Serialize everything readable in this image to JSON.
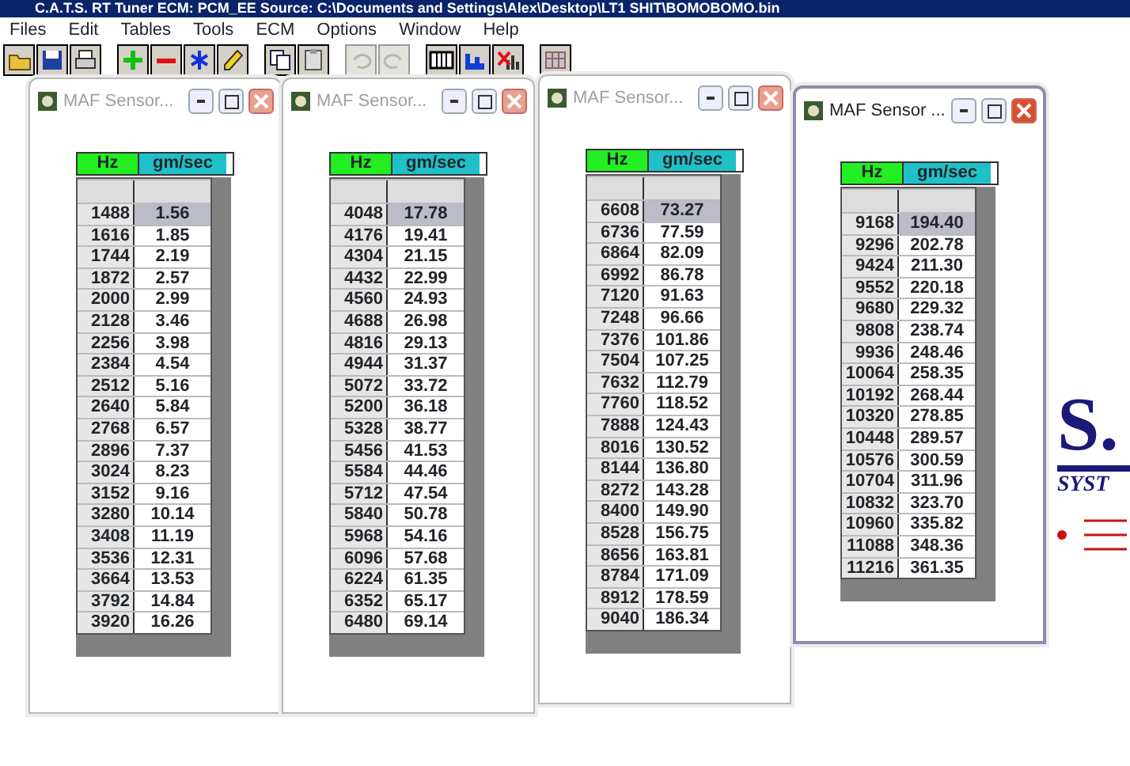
{
  "window": {
    "title": "C.A.T.S. RT Tuner     ECM: PCM_EE     Source: C:\\Documents and Settings\\Alex\\Desktop\\LT1 SHIT\\BOMOBOMO.bin"
  },
  "menu": [
    "Files",
    "Edit",
    "Tables",
    "Tools",
    "ECM",
    "Options",
    "Window",
    "Help"
  ],
  "toolbar": [
    [
      {
        "kind": "open",
        "disabled": false
      },
      {
        "kind": "save",
        "disabled": false
      },
      {
        "kind": "print",
        "disabled": false
      }
    ],
    [
      {
        "kind": "plus",
        "disabled": false
      },
      {
        "kind": "minus",
        "disabled": false
      },
      {
        "kind": "asterisk",
        "disabled": false
      },
      {
        "kind": "pencil",
        "disabled": false
      }
    ],
    [
      {
        "kind": "copy",
        "disabled": false
      },
      {
        "kind": "paste",
        "disabled": false
      }
    ],
    [
      {
        "kind": "undo",
        "disabled": true
      },
      {
        "kind": "redo",
        "disabled": true
      }
    ],
    [
      {
        "kind": "table",
        "disabled": false
      },
      {
        "kind": "chart",
        "disabled": false
      },
      {
        "kind": "chartx",
        "disabled": false
      }
    ],
    [
      {
        "kind": "grid",
        "disabled": false
      }
    ]
  ],
  "background_logo": {
    "mark": "S.",
    "tagline": "SYST"
  },
  "child_windows": [
    {
      "title": "MAF Sensor...",
      "active": false,
      "columns": [
        "Hz",
        "gm/sec"
      ],
      "rows": [
        {
          "hz": "1488",
          "value": "1.56",
          "selected": true
        },
        {
          "hz": "1616",
          "value": "1.85",
          "selected": false
        },
        {
          "hz": "1744",
          "value": "2.19",
          "selected": false
        },
        {
          "hz": "1872",
          "value": "2.57",
          "selected": false
        },
        {
          "hz": "2000",
          "value": "2.99",
          "selected": false
        },
        {
          "hz": "2128",
          "value": "3.46",
          "selected": false
        },
        {
          "hz": "2256",
          "value": "3.98",
          "selected": false
        },
        {
          "hz": "2384",
          "value": "4.54",
          "selected": false
        },
        {
          "hz": "2512",
          "value": "5.16",
          "selected": false
        },
        {
          "hz": "2640",
          "value": "5.84",
          "selected": false
        },
        {
          "hz": "2768",
          "value": "6.57",
          "selected": false
        },
        {
          "hz": "2896",
          "value": "7.37",
          "selected": false
        },
        {
          "hz": "3024",
          "value": "8.23",
          "selected": false
        },
        {
          "hz": "3152",
          "value": "9.16",
          "selected": false
        },
        {
          "hz": "3280",
          "value": "10.14",
          "selected": false
        },
        {
          "hz": "3408",
          "value": "11.19",
          "selected": false
        },
        {
          "hz": "3536",
          "value": "12.31",
          "selected": false
        },
        {
          "hz": "3664",
          "value": "13.53",
          "selected": false
        },
        {
          "hz": "3792",
          "value": "14.84",
          "selected": false
        },
        {
          "hz": "3920",
          "value": "16.26",
          "selected": false
        }
      ]
    },
    {
      "title": "MAF Sensor...",
      "active": false,
      "columns": [
        "Hz",
        "gm/sec"
      ],
      "rows": [
        {
          "hz": "4048",
          "value": "17.78",
          "selected": true
        },
        {
          "hz": "4176",
          "value": "19.41",
          "selected": false
        },
        {
          "hz": "4304",
          "value": "21.15",
          "selected": false
        },
        {
          "hz": "4432",
          "value": "22.99",
          "selected": false
        },
        {
          "hz": "4560",
          "value": "24.93",
          "selected": false
        },
        {
          "hz": "4688",
          "value": "26.98",
          "selected": false
        },
        {
          "hz": "4816",
          "value": "29.13",
          "selected": false
        },
        {
          "hz": "4944",
          "value": "31.37",
          "selected": false
        },
        {
          "hz": "5072",
          "value": "33.72",
          "selected": false
        },
        {
          "hz": "5200",
          "value": "36.18",
          "selected": false
        },
        {
          "hz": "5328",
          "value": "38.77",
          "selected": false
        },
        {
          "hz": "5456",
          "value": "41.53",
          "selected": false
        },
        {
          "hz": "5584",
          "value": "44.46",
          "selected": false
        },
        {
          "hz": "5712",
          "value": "47.54",
          "selected": false
        },
        {
          "hz": "5840",
          "value": "50.78",
          "selected": false
        },
        {
          "hz": "5968",
          "value": "54.16",
          "selected": false
        },
        {
          "hz": "6096",
          "value": "57.68",
          "selected": false
        },
        {
          "hz": "6224",
          "value": "61.35",
          "selected": false
        },
        {
          "hz": "6352",
          "value": "65.17",
          "selected": false
        },
        {
          "hz": "6480",
          "value": "69.14",
          "selected": false
        }
      ]
    },
    {
      "title": "MAF Sensor...",
      "active": false,
      "columns": [
        "Hz",
        "gm/sec"
      ],
      "rows": [
        {
          "hz": "6608",
          "value": "73.27",
          "selected": true
        },
        {
          "hz": "6736",
          "value": "77.59",
          "selected": false
        },
        {
          "hz": "6864",
          "value": "82.09",
          "selected": false
        },
        {
          "hz": "6992",
          "value": "86.78",
          "selected": false
        },
        {
          "hz": "7120",
          "value": "91.63",
          "selected": false
        },
        {
          "hz": "7248",
          "value": "96.66",
          "selected": false
        },
        {
          "hz": "7376",
          "value": "101.86",
          "selected": false
        },
        {
          "hz": "7504",
          "value": "107.25",
          "selected": false
        },
        {
          "hz": "7632",
          "value": "112.79",
          "selected": false
        },
        {
          "hz": "7760",
          "value": "118.52",
          "selected": false
        },
        {
          "hz": "7888",
          "value": "124.43",
          "selected": false
        },
        {
          "hz": "8016",
          "value": "130.52",
          "selected": false
        },
        {
          "hz": "8144",
          "value": "136.80",
          "selected": false
        },
        {
          "hz": "8272",
          "value": "143.28",
          "selected": false
        },
        {
          "hz": "8400",
          "value": "149.90",
          "selected": false
        },
        {
          "hz": "8528",
          "value": "156.75",
          "selected": false
        },
        {
          "hz": "8656",
          "value": "163.81",
          "selected": false
        },
        {
          "hz": "8784",
          "value": "171.09",
          "selected": false
        },
        {
          "hz": "8912",
          "value": "178.59",
          "selected": false
        },
        {
          "hz": "9040",
          "value": "186.34",
          "selected": false
        }
      ]
    },
    {
      "title": "MAF Sensor ...",
      "active": true,
      "columns": [
        "Hz",
        "gm/sec"
      ],
      "rows": [
        {
          "hz": "9168",
          "value": "194.40",
          "selected": true
        },
        {
          "hz": "9296",
          "value": "202.78",
          "selected": false
        },
        {
          "hz": "9424",
          "value": "211.30",
          "selected": false
        },
        {
          "hz": "9552",
          "value": "220.18",
          "selected": false
        },
        {
          "hz": "9680",
          "value": "229.32",
          "selected": false
        },
        {
          "hz": "9808",
          "value": "238.74",
          "selected": false
        },
        {
          "hz": "9936",
          "value": "248.46",
          "selected": false
        },
        {
          "hz": "10064",
          "value": "258.35",
          "selected": false
        },
        {
          "hz": "10192",
          "value": "268.44",
          "selected": false
        },
        {
          "hz": "10320",
          "value": "278.85",
          "selected": false
        },
        {
          "hz": "10448",
          "value": "289.57",
          "selected": false
        },
        {
          "hz": "10576",
          "value": "300.59",
          "selected": false
        },
        {
          "hz": "10704",
          "value": "311.96",
          "selected": false
        },
        {
          "hz": "10832",
          "value": "323.70",
          "selected": false
        },
        {
          "hz": "10960",
          "value": "335.82",
          "selected": false
        },
        {
          "hz": "11088",
          "value": "348.36",
          "selected": false
        },
        {
          "hz": "11216",
          "value": "361.35",
          "selected": false
        }
      ]
    }
  ]
}
